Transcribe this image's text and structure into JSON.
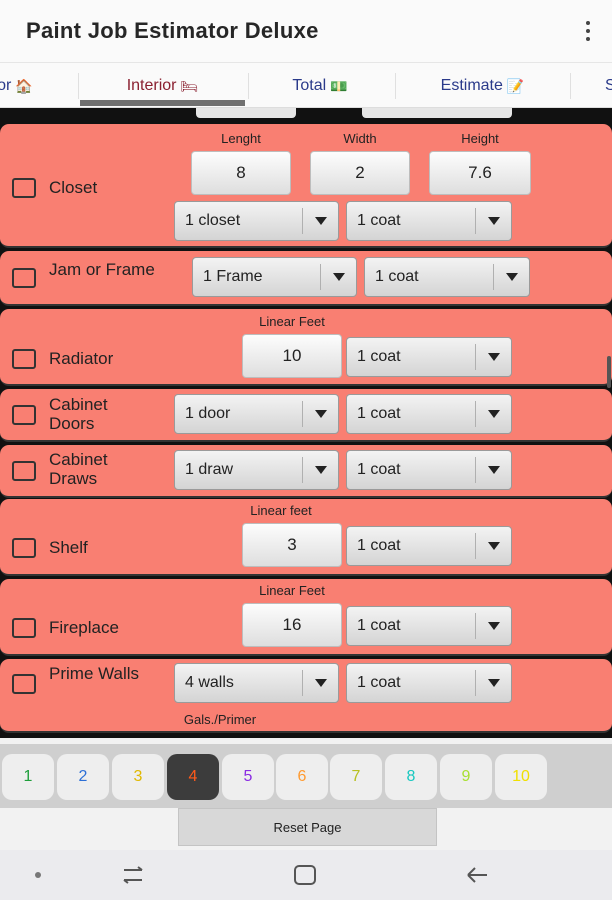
{
  "app": {
    "title": "Paint Job Estimator Deluxe"
  },
  "tabs": [
    {
      "label": "or",
      "icon": "🏠"
    },
    {
      "label": "Interior",
      "icon": "🛏"
    },
    {
      "label": "Total",
      "icon": "💵"
    },
    {
      "label": "Estimate",
      "icon": "📝"
    },
    {
      "label": "S",
      "icon": ""
    }
  ],
  "rows": {
    "closet": {
      "label": "Closet",
      "captions": {
        "length": "Lenght",
        "width": "Width",
        "height": "Height"
      },
      "length": "8",
      "width": "2",
      "height": "7.6",
      "select_qty": "1 closet",
      "select_coat": "1 coat"
    },
    "jam": {
      "label": "Jam or Frame",
      "select_qty": "1 Frame",
      "select_coat": "1 coat"
    },
    "radiator": {
      "label": "Radiator",
      "caption": "Linear Feet",
      "value": "10",
      "select_coat": "1 coat"
    },
    "cabinet_doors": {
      "label": "Cabinet Doors",
      "select_qty": "1 door",
      "select_coat": "1 coat"
    },
    "cabinet_draws": {
      "label": "Cabinet Draws",
      "select_qty": "1 draw",
      "select_coat": "1 coat"
    },
    "shelf": {
      "label": "Shelf",
      "caption": "Linear feet",
      "value": "3",
      "select_coat": "1 coat"
    },
    "fireplace": {
      "label": "Fireplace",
      "caption": "Linear Feet",
      "value": "16",
      "select_coat": "1 coat"
    },
    "prime_walls": {
      "label": "Prime Walls",
      "select_qty": "4 walls",
      "select_coat": "1 coat",
      "caption_below": "Gals./Primer"
    }
  },
  "pages": {
    "items": [
      "1",
      "2",
      "3",
      "4",
      "5",
      "6",
      "7",
      "8",
      "9",
      "10"
    ],
    "colors": [
      "#1e9e3a",
      "#2c6fd6",
      "#e0b800",
      "#ff5a1a",
      "#8a2be2",
      "#ff9a30",
      "#b8c020",
      "#18c8c0",
      "#a8e030",
      "#f0e000"
    ],
    "active_index": 3
  },
  "footer": {
    "reset_label": "Reset Page"
  },
  "colors": {
    "row_bg": "#f97f72",
    "accent_tab": "#8a2030",
    "tab_text": "#2a3a8a"
  }
}
